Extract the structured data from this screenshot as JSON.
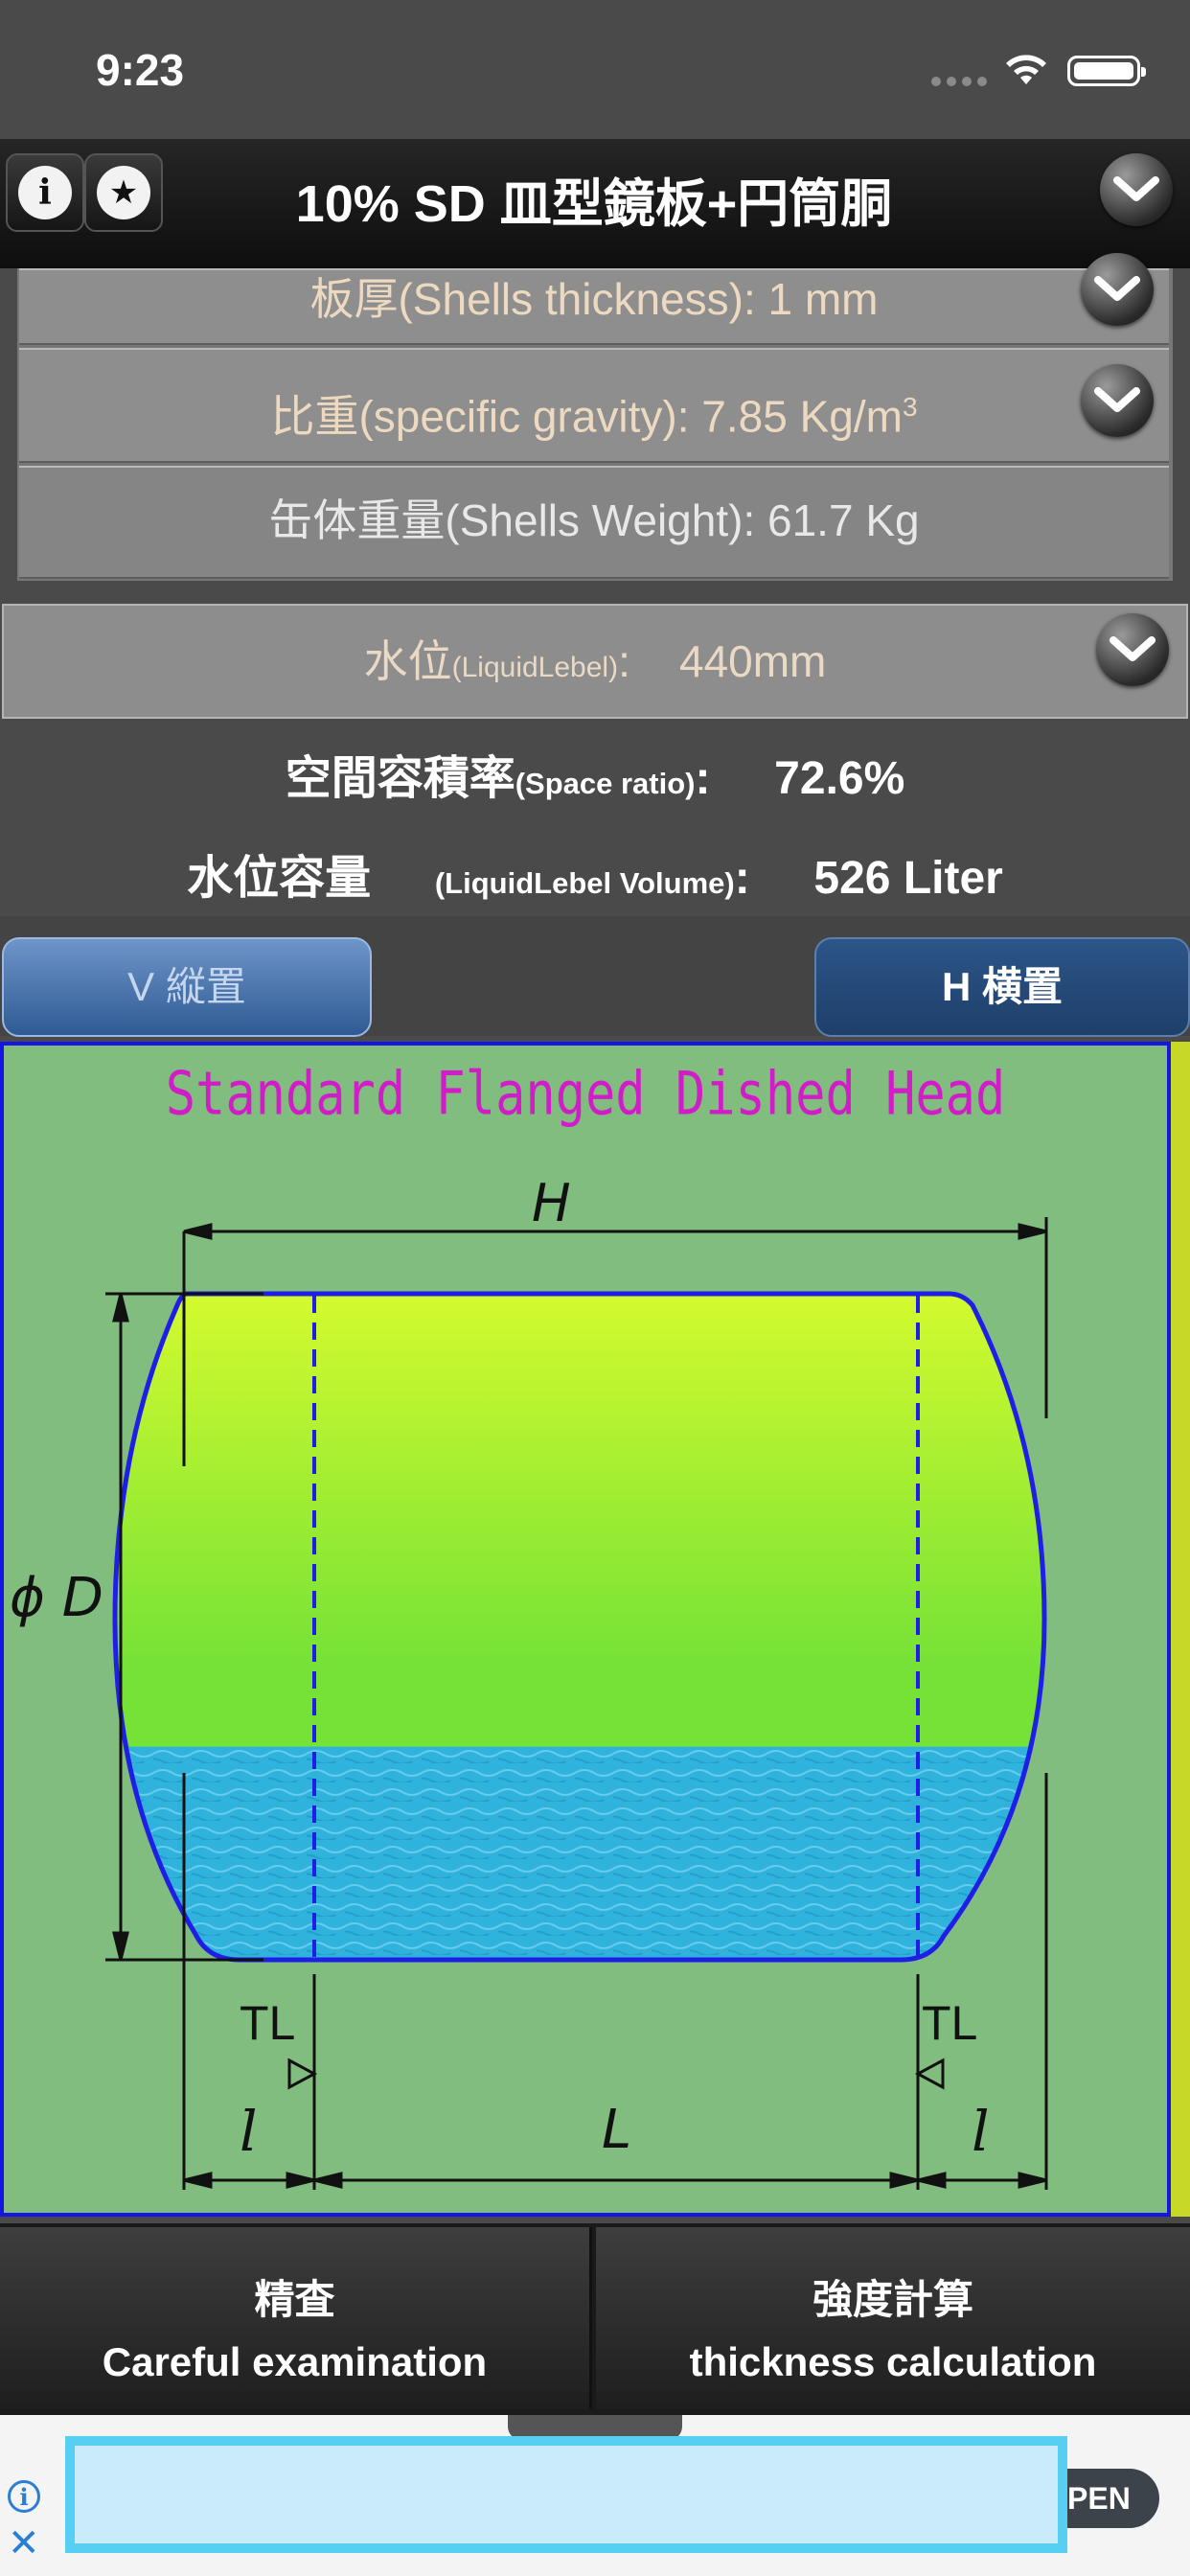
{
  "status": {
    "time": "9:23"
  },
  "nav": {
    "title": "10% SD 皿型鏡板+円筒胴",
    "info_glyph": "i",
    "star_glyph": "★"
  },
  "shell": {
    "thickness": "板厚(Shells thickness): 1 mm",
    "sg_text": "比重(specific gravity): 7.85 Kg/m",
    "sg_sup": "3",
    "weight": "缶体重量(Shells Weight): 61.7 Kg"
  },
  "liquid": {
    "label": "水位",
    "label_en": "(LiquidLebel)",
    "sep": ":",
    "value": "440mm"
  },
  "space_ratio": {
    "label": "空間容積率",
    "label_en": "(Space ratio)",
    "sep": ":",
    "value": "72.6%"
  },
  "liquid_volume": {
    "label": "水位容量",
    "label_en": "(LiquidLebel Volume)",
    "sep": ":",
    "value": "526 Liter"
  },
  "tabs": {
    "v": "V 縦置",
    "h": "H 横置"
  },
  "diagram": {
    "title": "Standard Flanged Dished Head",
    "labels": {
      "h": "H",
      "d": "ϕ D",
      "tl": "TL",
      "l_small": "l",
      "l_big": "L"
    },
    "liquid_fill_fraction": 0.32,
    "colors": {
      "vessel_top": "#d6fb2e",
      "vessel_mid": "#76e236",
      "water": "#2fb3dd",
      "outline": "#1e1ee6",
      "background": "#82bd80"
    }
  },
  "buttons": {
    "careful_jp": "精査",
    "careful_en": "Careful examination",
    "thick_jp": "強度計算",
    "thick_en": "thickness calculation"
  },
  "ad": {
    "open": "PEN",
    "close": "✕",
    "info": "i"
  },
  "icons": {
    "info": "info-icon",
    "star": "star-icon",
    "chevron": "chevron-down-icon",
    "wifi": "wifi-icon",
    "battery": "battery-icon"
  }
}
